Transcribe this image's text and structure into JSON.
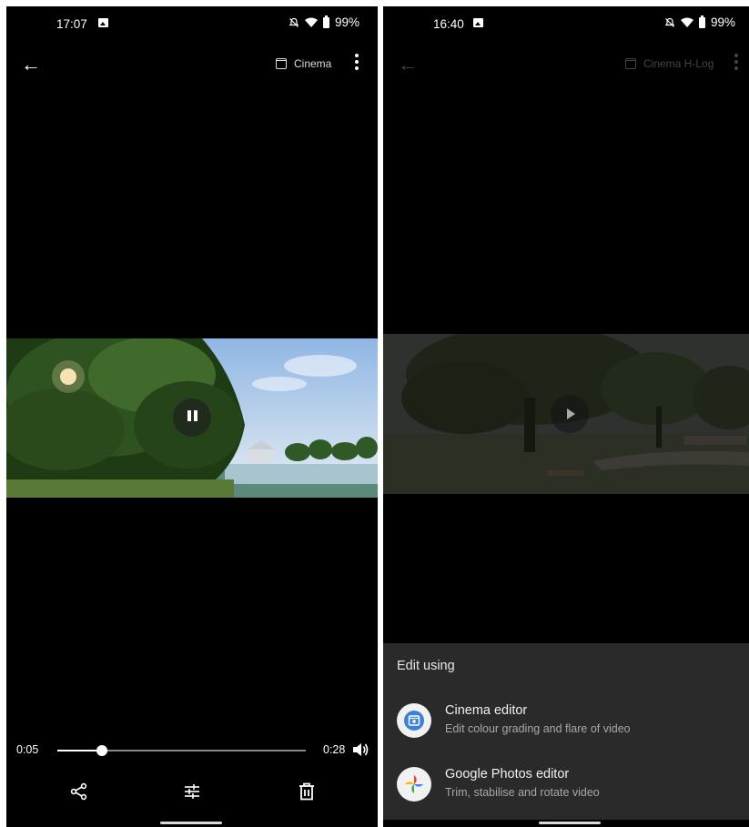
{
  "left": {
    "status": {
      "time": "17:07",
      "battery": "99%"
    },
    "topbar": {
      "mode_label": "Cinema"
    },
    "player": {
      "current_time": "0:05",
      "duration": "0:28",
      "progress": 0.178
    }
  },
  "right": {
    "status": {
      "time": "16:40",
      "battery": "99%"
    },
    "topbar": {
      "mode_label": "Cinema H-Log"
    },
    "sheet": {
      "title": "Edit using",
      "options": [
        {
          "title": "Cinema editor",
          "subtitle": "Edit colour grading and flare of video",
          "icon": "cinema-editor-icon"
        },
        {
          "title": "Google Photos editor",
          "subtitle": "Trim, stabilise and rotate video",
          "icon": "google-photos-icon"
        }
      ]
    }
  },
  "colors": {
    "accent_blue": "#3b82d6",
    "sheet_bg": "#2a2a2a"
  }
}
